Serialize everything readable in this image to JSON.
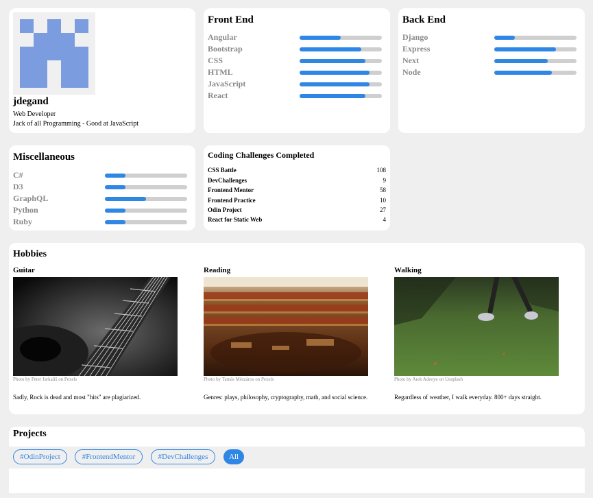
{
  "profile": {
    "username": "jdegand",
    "title": "Web Developer",
    "bio": "Jack of all Programming - Good at JavaScript"
  },
  "frontend": {
    "title": "Front End",
    "skills": [
      {
        "name": "Angular",
        "level": 0.5
      },
      {
        "name": "Bootstrap",
        "level": 0.75
      },
      {
        "name": "CSS",
        "level": 0.8
      },
      {
        "name": "HTML",
        "level": 0.85
      },
      {
        "name": "JavaScript",
        "level": 0.85
      },
      {
        "name": "React",
        "level": 0.8
      }
    ]
  },
  "backend": {
    "title": "Back End",
    "skills": [
      {
        "name": "Django",
        "level": 0.25
      },
      {
        "name": "Express",
        "level": 0.75
      },
      {
        "name": "Next",
        "level": 0.65
      },
      {
        "name": "Node",
        "level": 0.7
      }
    ]
  },
  "misc": {
    "title": "Miscellaneous",
    "skills": [
      {
        "name": "C#",
        "level": 0.25
      },
      {
        "name": "D3",
        "level": 0.25
      },
      {
        "name": "GraphQL",
        "level": 0.5
      },
      {
        "name": "Python",
        "level": 0.25
      },
      {
        "name": "Ruby",
        "level": 0.25
      }
    ]
  },
  "challenges": {
    "title": "Coding Challenges Completed",
    "items": [
      {
        "name": "CSS Battle",
        "count": "108"
      },
      {
        "name": "DevChallenges",
        "count": "9"
      },
      {
        "name": "Frontend Mentor",
        "count": "58"
      },
      {
        "name": "Frontend Practice",
        "count": "10"
      },
      {
        "name": "Odin Project",
        "count": "27"
      },
      {
        "name": "React for Static Web",
        "count": "4"
      }
    ]
  },
  "hobbies": {
    "title": "Hobbies",
    "items": [
      {
        "name": "Guitar",
        "credit": "Photo by Peter Jarkališ on Pexels",
        "description": "Sadly, Rock is dead and most \"hits\" are plagiarized."
      },
      {
        "name": "Reading",
        "credit": "Photo by Tamás Mészáros on Pexels",
        "description": "Genres: plays, philosophy, cryptography, math, and social science."
      },
      {
        "name": "Walking",
        "credit": "Photo by Arek Adeoye on Unsplash",
        "description": "Regardless of weather, I walk everyday. 800+ days straight."
      }
    ]
  },
  "projects": {
    "title": "Projects",
    "filters": [
      "#OdinProject",
      "#FrontendMentor",
      "#DevChallenges",
      "All"
    ],
    "active_filter": "All"
  },
  "colors": {
    "accent": "#2e86e5",
    "avatar": "#7b9de0",
    "track": "#cfcfcf",
    "muted_text": "#8a8a8a"
  }
}
